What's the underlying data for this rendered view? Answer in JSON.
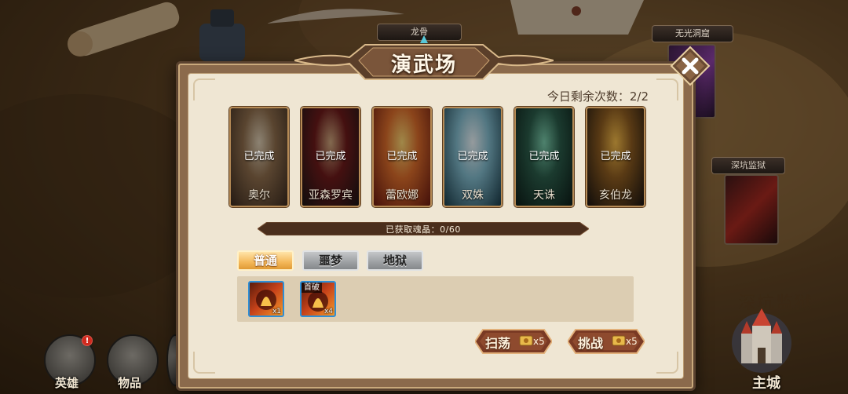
{
  "map": {
    "tag_top": "龙骨",
    "tag_right_top": "无光洞窟",
    "tag_right_mid": "深坑监狱",
    "scribble": "深坑监狱"
  },
  "bottom_nav": {
    "items": [
      {
        "label": "英雄",
        "badge": "!"
      },
      {
        "label": "物品"
      }
    ],
    "home_label": "主城"
  },
  "modal": {
    "title": "演武场",
    "remaining_label": "今日剩余次数：2/2",
    "heroes": [
      {
        "name": "奥尔",
        "status": "已完成",
        "c1": "#3a2a1e",
        "c2": "#8a6a4a",
        "c3": "#d8c9b0"
      },
      {
        "name": "亚森罗宾",
        "status": "已完成",
        "c1": "#1a1515",
        "c2": "#6a1a1a",
        "c3": "#c9a27a"
      },
      {
        "name": "蕾欧娜",
        "status": "已完成",
        "c1": "#6a1a10",
        "c2": "#d66a2a",
        "c3": "#f5d070"
      },
      {
        "name": "双姝",
        "status": "已完成",
        "c1": "#1a3b48",
        "c2": "#7fb7c8",
        "c3": "#e5eef2"
      },
      {
        "name": "天诛",
        "status": "已完成",
        "c1": "#0d1d18",
        "c2": "#2a5a48",
        "c3": "#78c8a8"
      },
      {
        "name": "亥伯龙",
        "status": "已完成",
        "c1": "#1a1410",
        "c2": "#8a5a20",
        "c3": "#f0b848"
      }
    ],
    "soul_progress": "已获取魂晶：0/60",
    "tabs": [
      {
        "label": "普通",
        "active": true
      },
      {
        "label": "噩梦",
        "active": false
      },
      {
        "label": "地狱",
        "active": false
      }
    ],
    "rewards": [
      {
        "qty": "x1",
        "tag": ""
      },
      {
        "qty": "x4",
        "tag": "首破"
      }
    ],
    "sweep": {
      "label": "扫荡",
      "count": "x5"
    },
    "challenge": {
      "label": "挑战",
      "count": "x5"
    }
  }
}
